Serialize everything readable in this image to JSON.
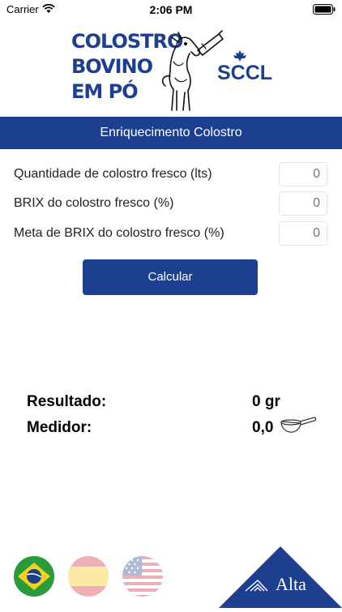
{
  "status_bar": {
    "carrier": "Carrier",
    "time": "2:06 PM"
  },
  "logo": {
    "lines": [
      "COLOSTRO",
      "BOVINO",
      "EM PÓ"
    ],
    "brand": "SCCL",
    "brand_color": "#1d3f8f"
  },
  "header": {
    "title": "Enriquecimento Colostro"
  },
  "form": {
    "fields": [
      {
        "label": "Quantidade de colostro fresco (lts)",
        "placeholder": "0"
      },
      {
        "label": "BRIX do colostro fresco (%)",
        "placeholder": "0"
      },
      {
        "label": "Meta de BRIX do colostro fresco (%)",
        "placeholder": "0"
      }
    ],
    "calculate_label": "Calcular"
  },
  "results": {
    "result_label": "Resultado:",
    "result_value": "0 gr",
    "meter_label": "Medidor:",
    "meter_value": "0,0",
    "meter_icon": "scoop-icon"
  },
  "footer": {
    "languages": [
      "brazil-flag-icon",
      "spain-flag-icon",
      "usa-flag-icon"
    ],
    "brand": "Alta"
  }
}
